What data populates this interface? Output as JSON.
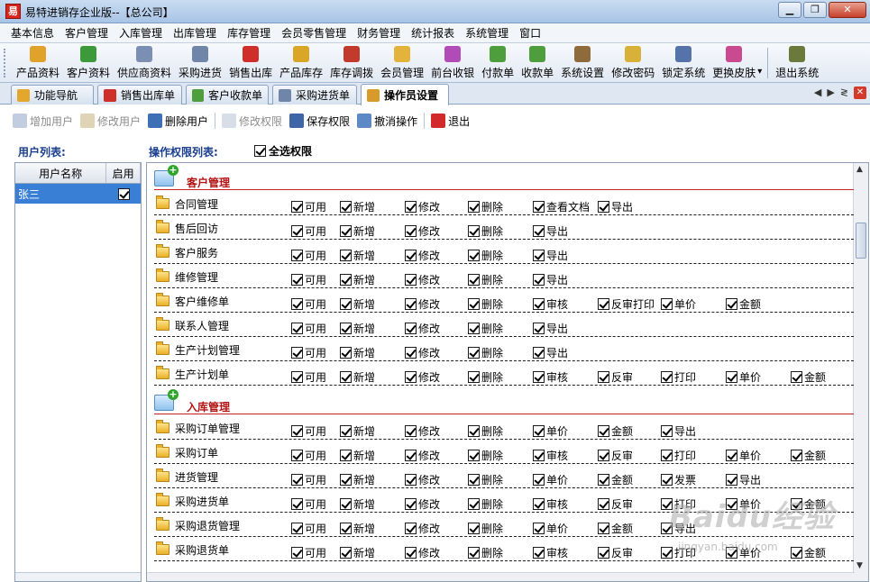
{
  "window": {
    "icon_text": "易",
    "title": "易特进销存企业版--【总公司】"
  },
  "menu": [
    "基本信息",
    "客户管理",
    "入库管理",
    "出库管理",
    "库存管理",
    "会员零售管理",
    "财务管理",
    "统计报表",
    "系统管理",
    "窗口"
  ],
  "toolbar": [
    {
      "label": "产品资料",
      "icon": "product-info-icon",
      "color": "#e0a22a"
    },
    {
      "label": "客户资料",
      "icon": "customer-info-icon",
      "color": "#3d9a3a"
    },
    {
      "label": "供应商资料",
      "icon": "supplier-icon",
      "color": "#7a8fb3"
    },
    {
      "label": "采购进货",
      "icon": "purchase-icon",
      "color": "#6f86a8"
    },
    {
      "label": "销售出库",
      "icon": "sales-outbound-icon",
      "color": "#cf2f2a"
    },
    {
      "label": "产品库存",
      "icon": "inventory-icon",
      "color": "#d9a625"
    },
    {
      "label": "库存调拨",
      "icon": "transfer-icon",
      "color": "#c23a2c"
    },
    {
      "label": "会员管理",
      "icon": "member-icon",
      "color": "#e4b33c"
    },
    {
      "label": "前台收银",
      "icon": "cashier-icon",
      "color": "#b14bb7"
    },
    {
      "label": "付款单",
      "icon": "payment-icon",
      "color": "#4f9e3e"
    },
    {
      "label": "收款单",
      "icon": "receipt-icon",
      "color": "#4f9e3e"
    },
    {
      "label": "系统设置",
      "icon": "settings-icon",
      "color": "#8e6b3b"
    },
    {
      "label": "修改密码",
      "icon": "password-icon",
      "color": "#d8b13a"
    },
    {
      "label": "锁定系统",
      "icon": "lock-icon",
      "color": "#5573a8"
    },
    {
      "label": "更换皮肤",
      "icon": "skin-icon",
      "color": "#c94a8e"
    },
    {
      "label": "退出系统",
      "icon": "exit-icon",
      "color": "#6b7a3b"
    }
  ],
  "tabs": [
    {
      "label": "功能导航",
      "icon": "nav-icon",
      "color": "#e2a72c"
    },
    {
      "label": "销售出库单",
      "icon": "sales-order-icon",
      "color": "#cf2f2a"
    },
    {
      "label": "客户收款单",
      "icon": "customer-receipt-icon",
      "color": "#4f9e3e"
    },
    {
      "label": "采购进货单",
      "icon": "purchase-order-icon",
      "color": "#6f86a8"
    },
    {
      "label": "操作员设置",
      "icon": "operator-icon",
      "color": "#d89a2b"
    }
  ],
  "actions": [
    {
      "label": "增加用户",
      "icon": "add-user-icon",
      "enabled": false
    },
    {
      "label": "修改用户",
      "icon": "edit-user-icon",
      "enabled": false
    },
    {
      "label": "删除用户",
      "icon": "delete-user-icon",
      "enabled": true
    },
    {
      "label": "修改权限",
      "icon": "edit-permission-icon",
      "enabled": false
    },
    {
      "label": "保存权限",
      "icon": "save-icon",
      "enabled": true
    },
    {
      "label": "撤消操作",
      "icon": "undo-icon",
      "enabled": true
    },
    {
      "label": "退出",
      "icon": "exit-red-icon",
      "enabled": true
    }
  ],
  "user_list": {
    "label": "用户列表:",
    "columns": [
      "用户名称",
      "启用"
    ],
    "rows": [
      {
        "name": "张三",
        "enabled": true
      }
    ]
  },
  "permissions": {
    "label": "操作权限列表:",
    "select_all": "全选权限",
    "groups": [
      {
        "title": "客户管理",
        "items": [
          {
            "name": "合同管理",
            "perms": [
              "可用",
              "新增",
              "修改",
              "删除",
              "查看文档",
              "导出"
            ]
          },
          {
            "name": "售后回访",
            "perms": [
              "可用",
              "新增",
              "修改",
              "删除",
              "导出"
            ]
          },
          {
            "name": "客户服务",
            "perms": [
              "可用",
              "新增",
              "修改",
              "删除",
              "导出"
            ]
          },
          {
            "name": "维修管理",
            "perms": [
              "可用",
              "新增",
              "修改",
              "删除",
              "导出"
            ]
          },
          {
            "name": "客户维修单",
            "perms": [
              "可用",
              "新增",
              "修改",
              "删除",
              "审核",
              "反审打印",
              "单价",
              "金额"
            ]
          },
          {
            "name": "联系人管理",
            "perms": [
              "可用",
              "新增",
              "修改",
              "删除",
              "导出"
            ]
          },
          {
            "name": "生产计划管理",
            "perms": [
              "可用",
              "新增",
              "修改",
              "删除",
              "导出"
            ]
          },
          {
            "name": "生产计划单",
            "perms": [
              "可用",
              "新增",
              "修改",
              "删除",
              "审核",
              "反审",
              "打印",
              "单价",
              "金额"
            ]
          }
        ]
      },
      {
        "title": "入库管理",
        "items": [
          {
            "name": "采购订单管理",
            "perms": [
              "可用",
              "新增",
              "修改",
              "删除",
              "单价",
              "金额",
              "导出"
            ]
          },
          {
            "name": "采购订单",
            "perms": [
              "可用",
              "新增",
              "修改",
              "删除",
              "审核",
              "反审",
              "打印",
              "单价",
              "金额"
            ]
          },
          {
            "name": "进货管理",
            "perms": [
              "可用",
              "新增",
              "修改",
              "删除",
              "单价",
              "金额",
              "发票",
              "导出"
            ]
          },
          {
            "name": "采购进货单",
            "perms": [
              "可用",
              "新增",
              "修改",
              "删除",
              "审核",
              "反审",
              "打印",
              "单价",
              "金额"
            ]
          },
          {
            "name": "采购退货管理",
            "perms": [
              "可用",
              "新增",
              "修改",
              "删除",
              "单价",
              "金额",
              "导出"
            ]
          },
          {
            "name": "采购退货单",
            "perms": [
              "可用",
              "新增",
              "修改",
              "删除",
              "审核",
              "反审",
              "打印",
              "单价",
              "金额"
            ]
          }
        ]
      }
    ]
  },
  "watermark": {
    "text": "Baidu经验",
    "sub": "jingyan.baidu.com"
  }
}
